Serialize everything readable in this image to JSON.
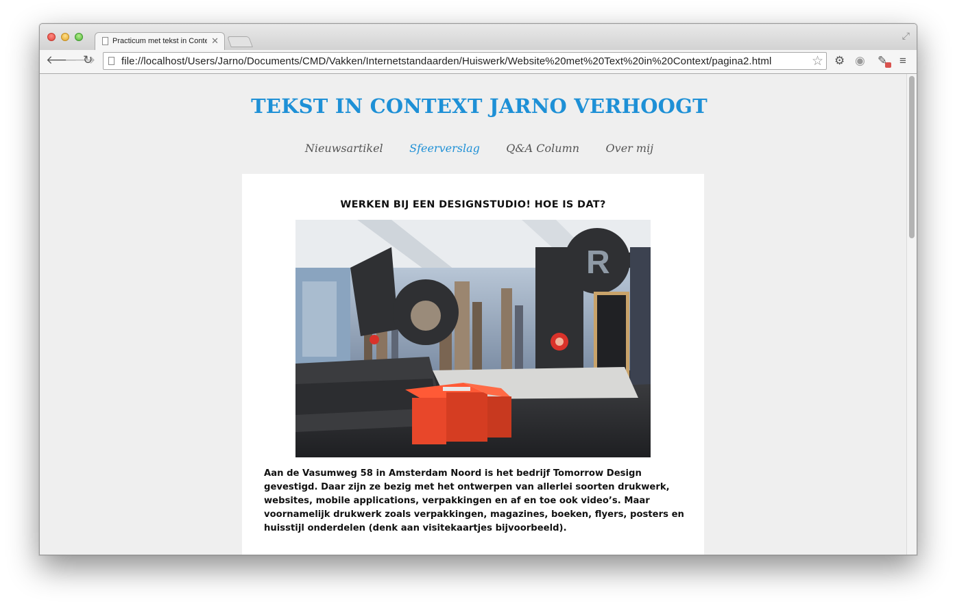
{
  "browser": {
    "tab_title": "Practicum met tekst in Context",
    "tab_close": "✕",
    "url": "file://localhost/Users/Jarno/Documents/CMD/Vakken/Internetstandaarden/Huiswerk/Website%20met%20Text%20in%20Context/pagina2.html",
    "icons": {
      "back": "back-arrow-icon",
      "forward": "forward-arrow-icon",
      "reload": "reload-icon",
      "star": "star-icon",
      "settings": "gear-icon",
      "extension": "extension-icon",
      "eyedropper": "eyedropper-icon",
      "menu": "menu-icon"
    }
  },
  "site": {
    "title": "TEKST IN CONTEXT JARNO VERHOOGT",
    "nav": [
      "Nieuwsartikel",
      "Sfeerverslag",
      "Q&A Column",
      "Over mij"
    ],
    "active_nav": "Sfeerverslag",
    "accent_color": "#1e90d6"
  },
  "article": {
    "title": "WERKEN BIJ EEN DESIGNSTUDIO! HOE IS DAT?",
    "paragraph": "Aan de Vasumweg 58 in Amsterdam Noord is het bedrijf Tomorrow Design gevestigd. Daar zijn ze bezig met het ontwerpen van allerlei soorten drukwerk, websites, mobile applications, verpakkingen en af en toe ook video’s. Maar voornamelijk drukwerk zoals verpakkingen, magazines, boeken, flyers, posters en huisstijl onderdelen (denk aan visitekaartjes bijvoorbeeld)."
  }
}
